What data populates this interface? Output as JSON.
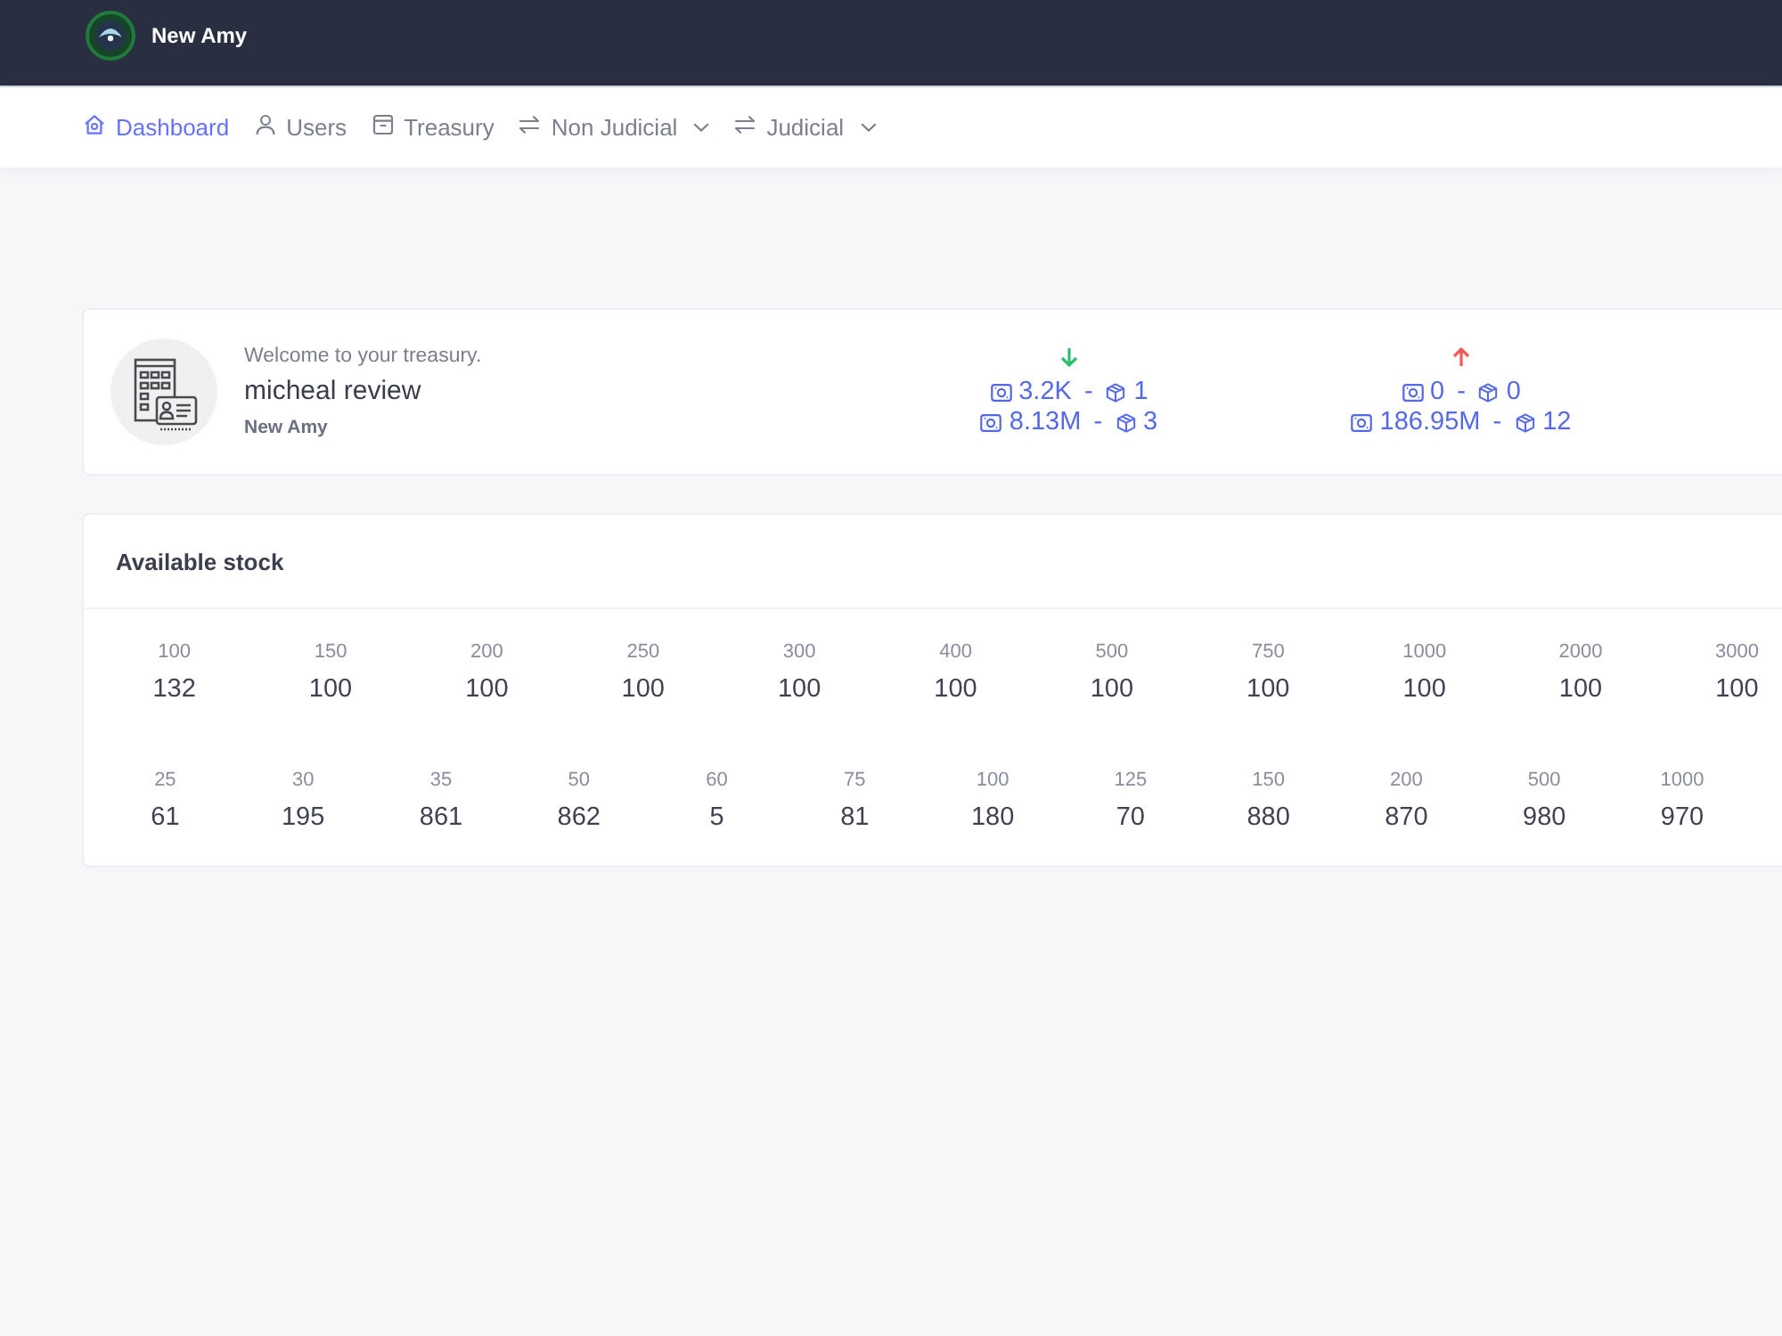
{
  "header": {
    "brand": "New Amy"
  },
  "nav": [
    {
      "label": "Dashboard",
      "selected": true,
      "dropdown": false
    },
    {
      "label": "Users",
      "selected": false,
      "dropdown": false
    },
    {
      "label": "Treasury",
      "selected": false,
      "dropdown": false
    },
    {
      "label": "Non Judicial",
      "selected": false,
      "dropdown": true
    },
    {
      "label": "Judicial",
      "selected": false,
      "dropdown": true
    }
  ],
  "welcome": {
    "greeting": "Welcome to your treasury.",
    "name": "micheal review",
    "organization": "New Amy"
  },
  "stats": [
    {
      "kind": "down",
      "lines": [
        {
          "amount": "3.2K",
          "separator": "-",
          "count": "1"
        },
        {
          "amount": "8.13M",
          "separator": "-",
          "count": "3"
        }
      ]
    },
    {
      "kind": "up",
      "lines": [
        {
          "amount": "0",
          "separator": "-",
          "count": "0"
        },
        {
          "amount": "186.95M",
          "separator": "-",
          "count": "12"
        }
      ]
    }
  ],
  "stock": {
    "title": "Available stock",
    "groups": [
      {
        "items": [
          {
            "label": "100",
            "value": "132"
          },
          {
            "label": "150",
            "value": "100"
          },
          {
            "label": "200",
            "value": "100"
          },
          {
            "label": "250",
            "value": "100"
          },
          {
            "label": "300",
            "value": "100"
          },
          {
            "label": "400",
            "value": "100"
          },
          {
            "label": "500",
            "value": "100"
          },
          {
            "label": "750",
            "value": "100"
          },
          {
            "label": "1000",
            "value": "100"
          },
          {
            "label": "2000",
            "value": "100"
          },
          {
            "label": "3000",
            "value": "100"
          }
        ]
      },
      {
        "items": [
          {
            "label": "25",
            "value": "61"
          },
          {
            "label": "30",
            "value": "195"
          },
          {
            "label": "35",
            "value": "861"
          },
          {
            "label": "50",
            "value": "862"
          },
          {
            "label": "60",
            "value": "5"
          },
          {
            "label": "75",
            "value": "81"
          },
          {
            "label": "100",
            "value": "180"
          },
          {
            "label": "125",
            "value": "70"
          },
          {
            "label": "150",
            "value": "880"
          },
          {
            "label": "200",
            "value": "870"
          },
          {
            "label": "500",
            "value": "980"
          },
          {
            "label": "1000",
            "value": "970"
          }
        ]
      }
    ]
  }
}
